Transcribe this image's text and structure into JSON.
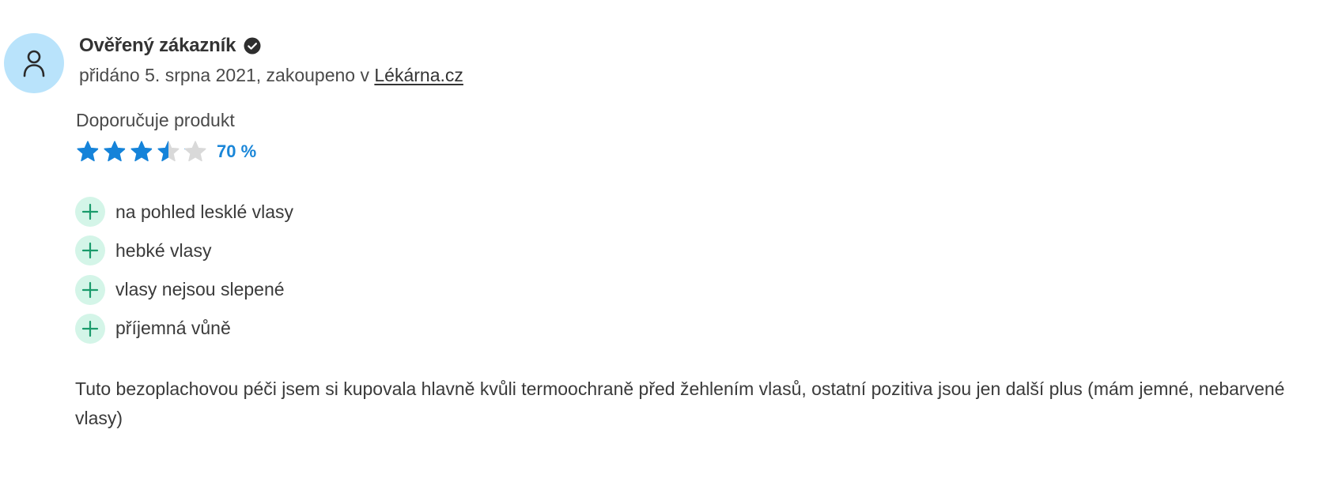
{
  "review": {
    "author": "Ověřený zákazník",
    "avatar_icon": "user-icon",
    "verified_icon": "verified-check-icon",
    "meta_prefix": "přidáno 5. srpna 2021, zakoupeno v ",
    "store_link": "Lékárna.cz",
    "recommend_label": "Doporučuje produkt",
    "rating": {
      "percent_label": "70 %",
      "value": 3.5,
      "max": 5,
      "filled_color": "#1583d9",
      "empty_color": "#d9d9d9"
    },
    "pros": [
      {
        "icon": "plus-icon",
        "text": "na pohled lesklé vlasy"
      },
      {
        "icon": "plus-icon",
        "text": "hebké vlasy"
      },
      {
        "icon": "plus-icon",
        "text": "vlasy nejsou slepené"
      },
      {
        "icon": "plus-icon",
        "text": "příjemná vůně"
      }
    ],
    "text": "Tuto bezoplachovou péči jsem si kupovala hlavně kvůli termoochraně před žehlením vlasů, ostatní pozitiva jsou jen další plus (mám jemné, nebarvené vlasy)",
    "colors": {
      "avatar_bg": "#b9e3fb",
      "plus_bg": "#d4f5e8",
      "plus_fg": "#1a9b6b",
      "accent": "#1a86d8"
    }
  }
}
